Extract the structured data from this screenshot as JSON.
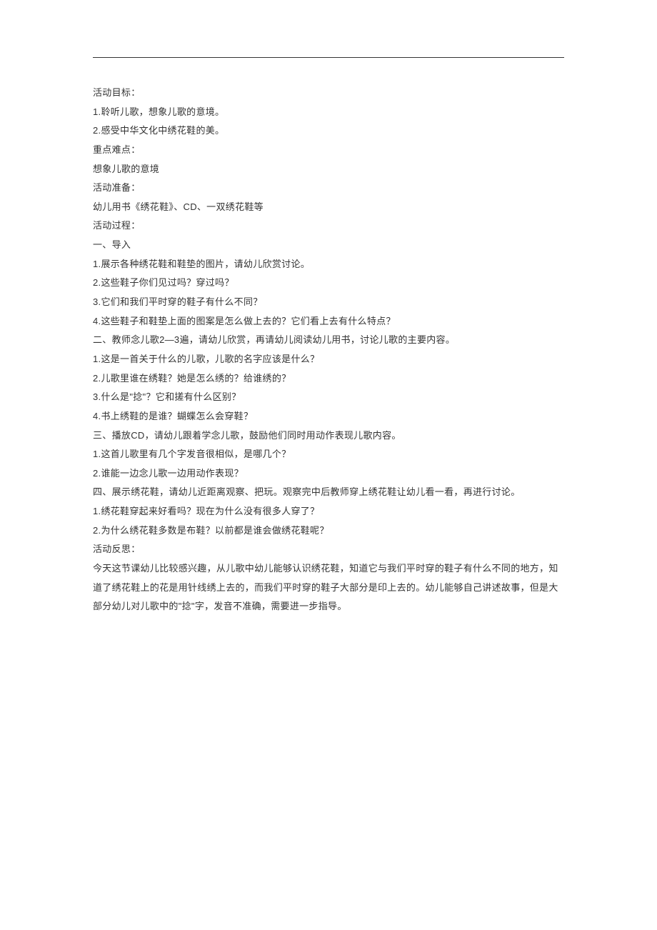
{
  "lines": [
    "活动目标：",
    "1.聆听儿歌，想象儿歌的意境。",
    "2.感受中华文化中绣花鞋的美。",
    "重点难点：",
    "想象儿歌的意境",
    "活动准备：",
    "幼儿用书《绣花鞋》、CD、一双绣花鞋等",
    "活动过程：",
    "一、导入",
    "1.展示各种绣花鞋和鞋垫的图片，请幼儿欣赏讨论。",
    "2.这些鞋子你们见过吗？穿过吗？",
    "3.它们和我们平时穿的鞋子有什么不同？",
    "4.这些鞋子和鞋垫上面的图案是怎么做上去的？它们看上去有什么特点？",
    "二、教师念儿歌2—3遍，请幼儿欣赏，再请幼儿阅读幼儿用书，讨论儿歌的主要内容。",
    "1.这是一首关于什么的儿歌，儿歌的名字应该是什么？",
    "2.儿歌里谁在绣鞋？她是怎么绣的？给谁绣的？",
    "3.什么是\"捻\"？它和搓有什么区别？",
    "4.书上绣鞋的是谁？蝴蝶怎么会穿鞋？",
    "三、播放CD，请幼儿跟着学念儿歌，鼓励他们同时用动作表现儿歌内容。",
    "1.这首儿歌里有几个字发音很相似，是哪几个？",
    "2.谁能一边念儿歌一边用动作表现？",
    "四、展示绣花鞋，请幼儿近距离观察、把玩。观察完中后教师穿上绣花鞋让幼儿看一看，再进行讨论。",
    "1.绣花鞋穿起来好看吗？现在为什么没有很多人穿了？",
    "2.为什么绣花鞋多数是布鞋？以前都是谁会做绣花鞋呢？",
    "活动反思：",
    "今天这节课幼儿比较感兴趣，从儿歌中幼儿能够认识绣花鞋，知道它与我们平时穿的鞋子有什么不同的地方，知道了绣花鞋上的花是用针线绣上去的，而我们平时穿的鞋子大部分是印上去的。幼儿能够自己讲述故事，但是大部分幼儿对儿歌中的\"捻\"字，发音不准确，需要进一步指导。"
  ]
}
